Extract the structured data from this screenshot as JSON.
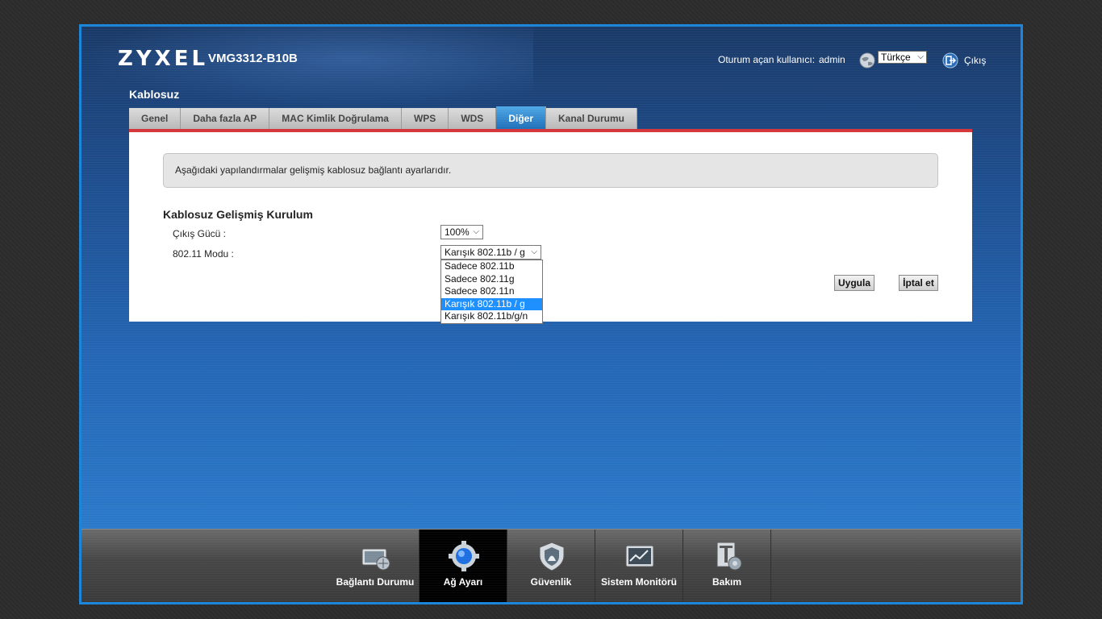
{
  "header": {
    "brand": "ZYXEL",
    "model": "VMG3312-B10B",
    "user_label": "Oturum açan kullanıcı:",
    "user_name": "admin",
    "language": "Türkçe",
    "logout": "Çıkış"
  },
  "section_title": "Kablosuz",
  "tabs": [
    {
      "label": "Genel"
    },
    {
      "label": "Daha fazla AP"
    },
    {
      "label": "MAC Kimlik Doğrulama"
    },
    {
      "label": "WPS"
    },
    {
      "label": "WDS"
    },
    {
      "label": "Diğer",
      "active": true
    },
    {
      "label": "Kanal Durumu"
    }
  ],
  "info_text": "Aşağıdaki yapılandırmalar gelişmiş kablosuz bağlantı ayarlarıdır.",
  "form": {
    "title": "Kablosuz Gelişmiş Kurulum",
    "power_label": "Çıkış Gücü :",
    "power_value": "100%",
    "mode_label": "802.11 Modu :",
    "mode_value": "Karışık 802.11b / g",
    "mode_options": [
      "Sadece 802.11b",
      "Sadece 802.11g",
      "Sadece 802.11n",
      "Karışık 802.11b / g",
      "Karışık 802.11b/g/n"
    ],
    "apply": "Uygula",
    "cancel": "İptal et"
  },
  "nav": [
    {
      "label": "Bağlantı Durumu",
      "icon": "connection-status-icon"
    },
    {
      "label": "Ağ Ayarı",
      "icon": "network-setting-icon",
      "active": true
    },
    {
      "label": "Güvenlik",
      "icon": "security-icon"
    },
    {
      "label": "Sistem Monitörü",
      "icon": "system-monitor-icon"
    },
    {
      "label": "Bakım",
      "icon": "maintenance-icon"
    }
  ],
  "colors": {
    "accent_blue": "#1e6fb8",
    "tab_underline": "#d4363c",
    "selected_option": "#1e90ff"
  }
}
